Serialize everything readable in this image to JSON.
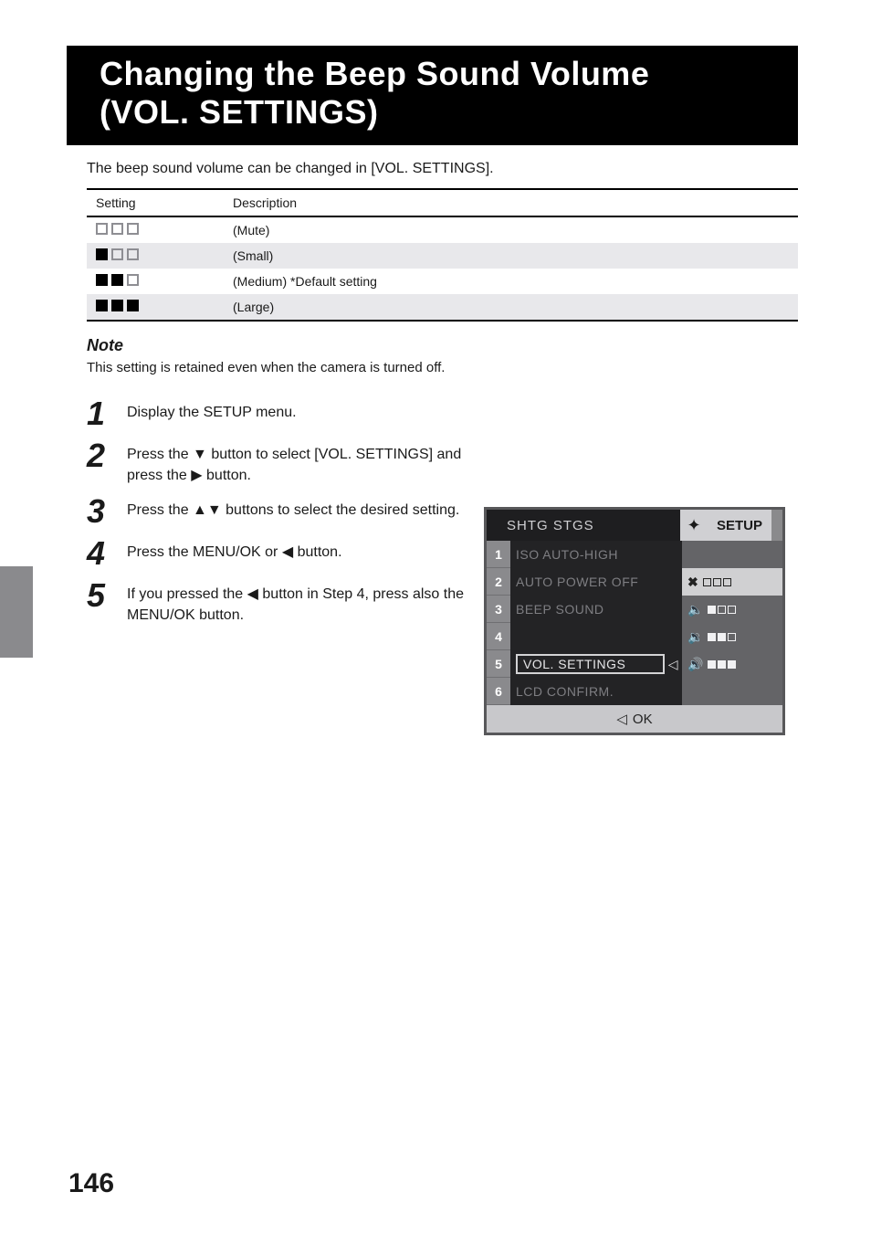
{
  "heading": {
    "line1": "Changing the Beep Sound Volume",
    "line2": "(VOL. SETTINGS)"
  },
  "intro": "The beep sound volume can be changed in [VOL. SETTINGS].",
  "table": {
    "head_setting": "Setting",
    "head_desc": "Description",
    "rows": [
      {
        "fill": 0,
        "desc": "(Mute)"
      },
      {
        "fill": 1,
        "desc": "(Small)"
      },
      {
        "fill": 2,
        "desc": "(Medium) *Default setting"
      },
      {
        "fill": 3,
        "desc": "(Large)"
      }
    ]
  },
  "note": {
    "head": "Note",
    "body": "This setting is retained even when the camera is turned off."
  },
  "steps": [
    {
      "n": "1",
      "t": "Display the SETUP menu."
    },
    {
      "n": "2",
      "t1": "Press the ",
      "t2": " button to select [VOL. SETTINGS] and press the ",
      "t3": " button."
    },
    {
      "n": "3",
      "t1": "Press the ",
      "t2": " buttons to select the desired setting."
    },
    {
      "n": "4",
      "t1": "Press the MENU/OK or ",
      "t2": " button."
    },
    {
      "n": "5",
      "t1": "If you pressed the ",
      "t2": " button in Step 4, press also the MENU/OK button."
    }
  ],
  "cam": {
    "tab1": "SHTG STGS",
    "tab2_icon": "tool-icon",
    "tab3": "SETUP",
    "menu_nums": [
      "1",
      "2",
      "3",
      "4",
      "5",
      "6"
    ],
    "menu_items": [
      "ISO AUTO-HIGH",
      "AUTO POWER OFF",
      "BEEP SOUND",
      "",
      "VOL. SETTINGS",
      "LCD CONFIRM."
    ],
    "vals": [
      {
        "icon": "mute",
        "fill": 0,
        "hi": true
      },
      {
        "icon": "low",
        "fill": 1
      },
      {
        "icon": "med",
        "fill": 2
      },
      {
        "icon": "high",
        "fill": 3
      }
    ],
    "ok": "OK"
  },
  "page_number": "146"
}
